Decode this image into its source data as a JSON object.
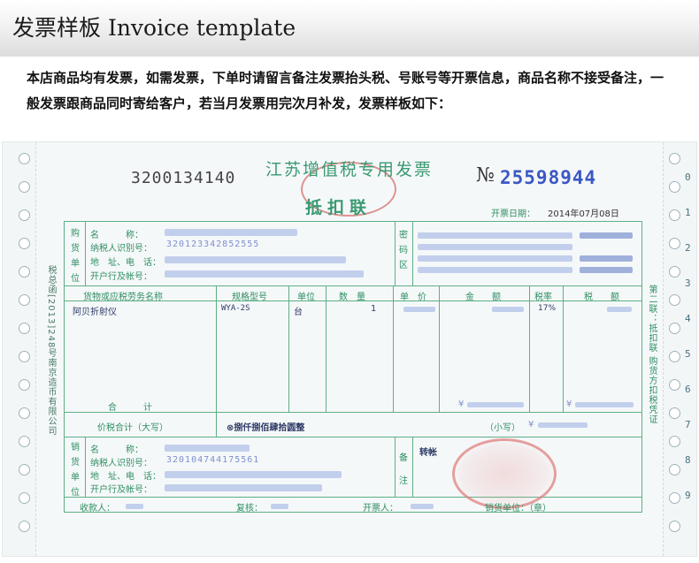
{
  "header": {
    "title": "发票样板 Invoice template"
  },
  "notice": {
    "text": "本店商品均有发票，如需发票，下单时请留言备注发票抬头税、号账号等开票信息，商品名称不接受备注，一般发票跟商品同时寄给客户，若当月发票用完次月补发，发票样板如下："
  },
  "invoice": {
    "code": "3200134140",
    "title": "江苏增值税专用发票",
    "copy_name": "抵扣联",
    "no_symbol": "№",
    "number": "25598944",
    "date_label": "开票日期：",
    "date_value": "2014年07月08日",
    "buyer": {
      "side_label": [
        "购",
        "货",
        "单",
        "位"
      ],
      "name_label": "名　　　称：",
      "tax_id_label": "纳税人识别号：",
      "tax_id_value": "320123342852555",
      "address_label": "地　址、电　话：",
      "bank_label": "开户行及帐号："
    },
    "cipher_label": [
      "密",
      "码",
      "区"
    ],
    "items_header": {
      "goods": "货物或应税劳务名称",
      "spec": "规格型号",
      "unit": "单位",
      "qty": "数　量",
      "price": "单　价",
      "amount": "金　　额",
      "tax_rate": "税率",
      "tax": "税　　额"
    },
    "item": {
      "goods": "阿贝折射仪",
      "spec": "WYA-2S",
      "unit": "台",
      "qty": "1",
      "tax_rate": "17%"
    },
    "subtotal_label": "合　　　计",
    "currency_symbol": "¥",
    "total_label": "价税合计（大写）",
    "total_words": "⊗捌仟捌佰肆拾圆整",
    "total_small_label": "（小写）",
    "seller": {
      "side_label": [
        "销",
        "货",
        "单",
        "位"
      ],
      "name_label": "名　　　称：",
      "tax_id_label": "纳税人识别号：",
      "tax_id_value": "320104744175561",
      "address_label": "地　址、电　话：",
      "bank_label": "开户行及帐号："
    },
    "remark_label": [
      "备",
      "注"
    ],
    "remark_value": "转帐",
    "footer": {
      "payee_label": "收款人：",
      "reviewer_label": "复核：",
      "drawer_label": "开票人：",
      "seller_label": "销货单位：（章）"
    },
    "side_left_text": "税总函[2013]248号南京造币有限公司",
    "side_right_text": "第二联：抵扣联 购货方扣税凭证",
    "right_digits": [
      "0",
      "1",
      "2",
      "3",
      "4",
      "5",
      "6",
      "7",
      "8",
      "9"
    ]
  },
  "colors": {
    "form_green": "#2f8f63",
    "print_blue": "#3b58c4",
    "stamp_red": "#d98080"
  }
}
